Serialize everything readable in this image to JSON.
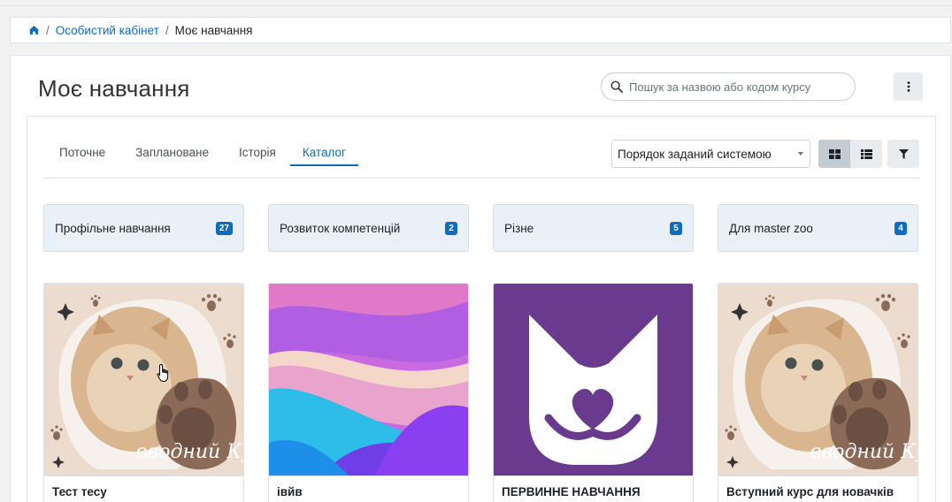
{
  "breadcrumb": {
    "home_icon": "home-icon",
    "items": [
      {
        "label": "Особистий кабінет"
      },
      {
        "label": "Моє навчання"
      }
    ]
  },
  "page": {
    "title": "Моє навчання"
  },
  "search": {
    "placeholder": "Пошук за назвою або кодом курсу",
    "icon": "search-icon"
  },
  "tabs": [
    {
      "label": "Поточне",
      "active": false
    },
    {
      "label": "Заплановане",
      "active": false
    },
    {
      "label": "Історія",
      "active": false
    },
    {
      "label": "Каталог",
      "active": true
    }
  ],
  "sort": {
    "selected": "Порядок заданий системою"
  },
  "categories": [
    {
      "label": "Профільне навчання",
      "count": "27"
    },
    {
      "label": "Розвиток компетенцій",
      "count": "2"
    },
    {
      "label": "Різне",
      "count": "5"
    },
    {
      "label": "Для master zoo",
      "count": "4"
    }
  ],
  "courses": [
    {
      "name": "Тест тесу",
      "image_text": "вводний Курс"
    },
    {
      "name": "івйв"
    },
    {
      "name": "ПЕРВИННЕ НАВЧАННЯ"
    },
    {
      "name": "Вступний курс для новачків",
      "image_text": "вводний Курс"
    }
  ],
  "colors": {
    "accent": "#0f6cbf",
    "brand_purple": "#6a3a8f",
    "category_bg": "#eaf0f7"
  }
}
